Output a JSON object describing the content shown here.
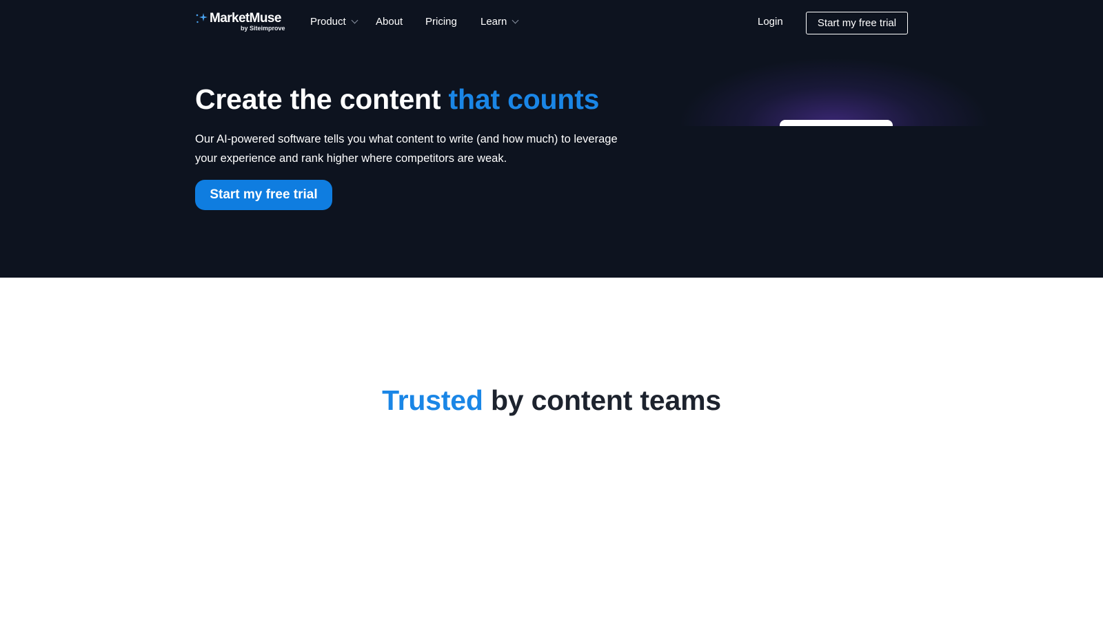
{
  "colors": {
    "hero_bg": "#0d131f",
    "accent": "#1a86e6",
    "cta_bg": "#0f7de0",
    "text_dark": "#1d232e",
    "glow": "#5f37b9"
  },
  "nav": {
    "logo": {
      "name": "MarketMuse",
      "byline": "by Siteimprove",
      "icon": "sparkle-icon"
    },
    "items": [
      {
        "label": "Product",
        "has_dropdown": true
      },
      {
        "label": "About",
        "has_dropdown": false
      },
      {
        "label": "Pricing",
        "has_dropdown": false
      },
      {
        "label": "Learn",
        "has_dropdown": true
      }
    ],
    "login_label": "Login",
    "cta_label": "Start my free trial"
  },
  "hero": {
    "title_main": "Create the content ",
    "title_accent": "that counts",
    "subtitle": "Our AI-powered software tells you what content to write (and how much) to leverage your experience and rank higher where competitors are weak.",
    "cta_label": "Start my free trial"
  },
  "trusted": {
    "accent": "Trusted",
    "rest": " by content teams"
  }
}
